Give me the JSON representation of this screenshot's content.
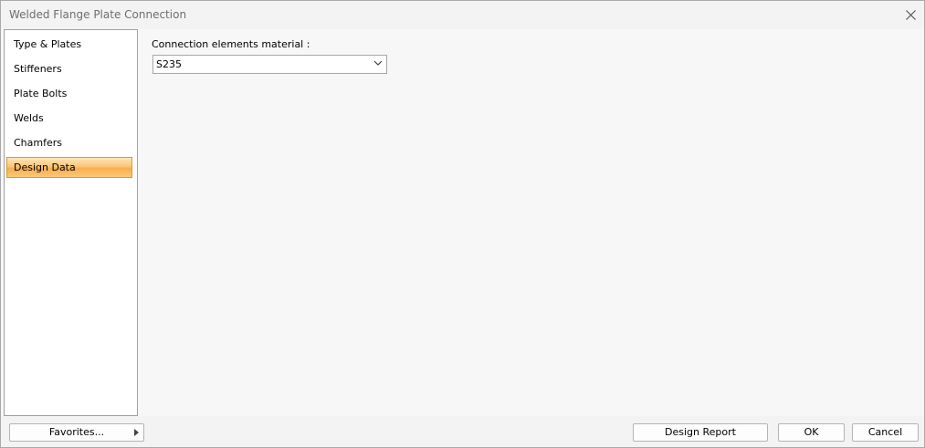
{
  "window": {
    "title": "Welded Flange Plate Connection"
  },
  "sidebar": {
    "items": [
      {
        "label": "Type & Plates"
      },
      {
        "label": "Stiffeners"
      },
      {
        "label": "Plate Bolts"
      },
      {
        "label": "Welds"
      },
      {
        "label": "Chamfers"
      },
      {
        "label": "Design Data",
        "selected": true
      }
    ]
  },
  "main": {
    "material_label": "Connection elements material :",
    "material_value": "S235"
  },
  "footer": {
    "favorites_label": "Favorites...",
    "design_report_label": "Design Report",
    "ok_label": "OK",
    "cancel_label": "Cancel"
  },
  "colors": {
    "selected_start": "#fde7b7",
    "selected_end": "#f9ae4f",
    "selected_border": "#d99834"
  },
  "icons": {
    "close": "close-icon",
    "dropdown": "chevron-down-icon",
    "submenu": "triangle-right-icon"
  }
}
